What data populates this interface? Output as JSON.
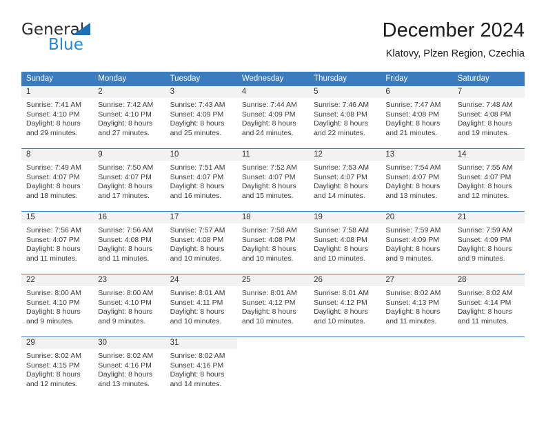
{
  "logo": {
    "word_one": "General",
    "word_two": "Blue",
    "triangle_icon": "blue-triangle-icon",
    "blue_hex": "#2287d4",
    "triangle_hex": "#1b70b8"
  },
  "header": {
    "title": "December 2024",
    "subtitle": "Klatovy, Plzen Region, Czechia"
  },
  "calendar": {
    "header_bg_hex": "#3a7cbd",
    "daynum_bg_hex": "#f2f2f2",
    "weekday_headers": [
      "Sunday",
      "Monday",
      "Tuesday",
      "Wednesday",
      "Thursday",
      "Friday",
      "Saturday"
    ],
    "weeks": [
      [
        {
          "day": "1",
          "sunrise": "Sunrise: 7:41 AM",
          "sunset": "Sunset: 4:10 PM",
          "daylight_1": "Daylight: 8 hours",
          "daylight_2": "and 29 minutes."
        },
        {
          "day": "2",
          "sunrise": "Sunrise: 7:42 AM",
          "sunset": "Sunset: 4:10 PM",
          "daylight_1": "Daylight: 8 hours",
          "daylight_2": "and 27 minutes."
        },
        {
          "day": "3",
          "sunrise": "Sunrise: 7:43 AM",
          "sunset": "Sunset: 4:09 PM",
          "daylight_1": "Daylight: 8 hours",
          "daylight_2": "and 25 minutes."
        },
        {
          "day": "4",
          "sunrise": "Sunrise: 7:44 AM",
          "sunset": "Sunset: 4:09 PM",
          "daylight_1": "Daylight: 8 hours",
          "daylight_2": "and 24 minutes."
        },
        {
          "day": "5",
          "sunrise": "Sunrise: 7:46 AM",
          "sunset": "Sunset: 4:08 PM",
          "daylight_1": "Daylight: 8 hours",
          "daylight_2": "and 22 minutes."
        },
        {
          "day": "6",
          "sunrise": "Sunrise: 7:47 AM",
          "sunset": "Sunset: 4:08 PM",
          "daylight_1": "Daylight: 8 hours",
          "daylight_2": "and 21 minutes."
        },
        {
          "day": "7",
          "sunrise": "Sunrise: 7:48 AM",
          "sunset": "Sunset: 4:08 PM",
          "daylight_1": "Daylight: 8 hours",
          "daylight_2": "and 19 minutes."
        }
      ],
      [
        {
          "day": "8",
          "sunrise": "Sunrise: 7:49 AM",
          "sunset": "Sunset: 4:07 PM",
          "daylight_1": "Daylight: 8 hours",
          "daylight_2": "and 18 minutes."
        },
        {
          "day": "9",
          "sunrise": "Sunrise: 7:50 AM",
          "sunset": "Sunset: 4:07 PM",
          "daylight_1": "Daylight: 8 hours",
          "daylight_2": "and 17 minutes."
        },
        {
          "day": "10",
          "sunrise": "Sunrise: 7:51 AM",
          "sunset": "Sunset: 4:07 PM",
          "daylight_1": "Daylight: 8 hours",
          "daylight_2": "and 16 minutes."
        },
        {
          "day": "11",
          "sunrise": "Sunrise: 7:52 AM",
          "sunset": "Sunset: 4:07 PM",
          "daylight_1": "Daylight: 8 hours",
          "daylight_2": "and 15 minutes."
        },
        {
          "day": "12",
          "sunrise": "Sunrise: 7:53 AM",
          "sunset": "Sunset: 4:07 PM",
          "daylight_1": "Daylight: 8 hours",
          "daylight_2": "and 14 minutes."
        },
        {
          "day": "13",
          "sunrise": "Sunrise: 7:54 AM",
          "sunset": "Sunset: 4:07 PM",
          "daylight_1": "Daylight: 8 hours",
          "daylight_2": "and 13 minutes."
        },
        {
          "day": "14",
          "sunrise": "Sunrise: 7:55 AM",
          "sunset": "Sunset: 4:07 PM",
          "daylight_1": "Daylight: 8 hours",
          "daylight_2": "and 12 minutes."
        }
      ],
      [
        {
          "day": "15",
          "sunrise": "Sunrise: 7:56 AM",
          "sunset": "Sunset: 4:07 PM",
          "daylight_1": "Daylight: 8 hours",
          "daylight_2": "and 11 minutes."
        },
        {
          "day": "16",
          "sunrise": "Sunrise: 7:56 AM",
          "sunset": "Sunset: 4:08 PM",
          "daylight_1": "Daylight: 8 hours",
          "daylight_2": "and 11 minutes."
        },
        {
          "day": "17",
          "sunrise": "Sunrise: 7:57 AM",
          "sunset": "Sunset: 4:08 PM",
          "daylight_1": "Daylight: 8 hours",
          "daylight_2": "and 10 minutes."
        },
        {
          "day": "18",
          "sunrise": "Sunrise: 7:58 AM",
          "sunset": "Sunset: 4:08 PM",
          "daylight_1": "Daylight: 8 hours",
          "daylight_2": "and 10 minutes."
        },
        {
          "day": "19",
          "sunrise": "Sunrise: 7:58 AM",
          "sunset": "Sunset: 4:08 PM",
          "daylight_1": "Daylight: 8 hours",
          "daylight_2": "and 10 minutes."
        },
        {
          "day": "20",
          "sunrise": "Sunrise: 7:59 AM",
          "sunset": "Sunset: 4:09 PM",
          "daylight_1": "Daylight: 8 hours",
          "daylight_2": "and 9 minutes."
        },
        {
          "day": "21",
          "sunrise": "Sunrise: 7:59 AM",
          "sunset": "Sunset: 4:09 PM",
          "daylight_1": "Daylight: 8 hours",
          "daylight_2": "and 9 minutes."
        }
      ],
      [
        {
          "day": "22",
          "sunrise": "Sunrise: 8:00 AM",
          "sunset": "Sunset: 4:10 PM",
          "daylight_1": "Daylight: 8 hours",
          "daylight_2": "and 9 minutes."
        },
        {
          "day": "23",
          "sunrise": "Sunrise: 8:00 AM",
          "sunset": "Sunset: 4:10 PM",
          "daylight_1": "Daylight: 8 hours",
          "daylight_2": "and 9 minutes."
        },
        {
          "day": "24",
          "sunrise": "Sunrise: 8:01 AM",
          "sunset": "Sunset: 4:11 PM",
          "daylight_1": "Daylight: 8 hours",
          "daylight_2": "and 10 minutes."
        },
        {
          "day": "25",
          "sunrise": "Sunrise: 8:01 AM",
          "sunset": "Sunset: 4:12 PM",
          "daylight_1": "Daylight: 8 hours",
          "daylight_2": "and 10 minutes."
        },
        {
          "day": "26",
          "sunrise": "Sunrise: 8:01 AM",
          "sunset": "Sunset: 4:12 PM",
          "daylight_1": "Daylight: 8 hours",
          "daylight_2": "and 10 minutes."
        },
        {
          "day": "27",
          "sunrise": "Sunrise: 8:02 AM",
          "sunset": "Sunset: 4:13 PM",
          "daylight_1": "Daylight: 8 hours",
          "daylight_2": "and 11 minutes."
        },
        {
          "day": "28",
          "sunrise": "Sunrise: 8:02 AM",
          "sunset": "Sunset: 4:14 PM",
          "daylight_1": "Daylight: 8 hours",
          "daylight_2": "and 11 minutes."
        }
      ],
      [
        {
          "day": "29",
          "sunrise": "Sunrise: 8:02 AM",
          "sunset": "Sunset: 4:15 PM",
          "daylight_1": "Daylight: 8 hours",
          "daylight_2": "and 12 minutes."
        },
        {
          "day": "30",
          "sunrise": "Sunrise: 8:02 AM",
          "sunset": "Sunset: 4:16 PM",
          "daylight_1": "Daylight: 8 hours",
          "daylight_2": "and 13 minutes."
        },
        {
          "day": "31",
          "sunrise": "Sunrise: 8:02 AM",
          "sunset": "Sunset: 4:16 PM",
          "daylight_1": "Daylight: 8 hours",
          "daylight_2": "and 14 minutes."
        },
        {
          "day": "",
          "sunrise": "",
          "sunset": "",
          "daylight_1": "",
          "daylight_2": ""
        },
        {
          "day": "",
          "sunrise": "",
          "sunset": "",
          "daylight_1": "",
          "daylight_2": ""
        },
        {
          "day": "",
          "sunrise": "",
          "sunset": "",
          "daylight_1": "",
          "daylight_2": ""
        },
        {
          "day": "",
          "sunrise": "",
          "sunset": "",
          "daylight_1": "",
          "daylight_2": ""
        }
      ]
    ]
  }
}
